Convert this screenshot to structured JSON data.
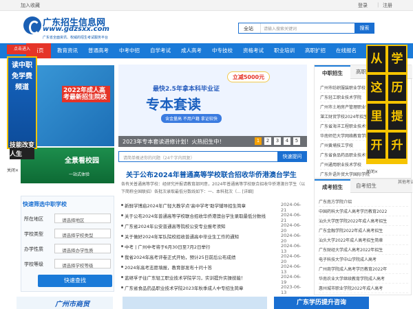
{
  "topbar": {
    "favorite": "加入收藏",
    "login": "登录",
    "sep": "|",
    "register": "注册"
  },
  "logo": {
    "title": "广东招生信息网",
    "domain": "www.gdzsxx.com",
    "slogan": "广东省全面资讯、权威的招生考试服务平台"
  },
  "search": {
    "select": "全站",
    "placeholder": "请输入搜索关键词",
    "button": "搜索"
  },
  "nav": {
    "home": "首页",
    "items": [
      "教育资讯",
      "普通高考",
      "中考中招",
      "自学考试",
      "成人高考",
      "中专技校",
      "资格考试",
      "职业培训",
      "高职扩招",
      "在线报名"
    ]
  },
  "left_float": {
    "ribbon": "点击进入",
    "v_text": "读中职免学费频道",
    "skill": "技能改变人生",
    "close": "关闭×"
  },
  "right_float": {
    "chars": [
      "学",
      "历",
      "提",
      "升"
    ],
    "chars2": [
      "从",
      "这",
      "里",
      "开",
      "始"
    ],
    "close": "关闭×"
  },
  "left_promo": {
    "tag": "2022年成人高考最新招生院校",
    "panorama": "全景看校园",
    "panorama_sub": "一站式体验"
  },
  "quick": {
    "title": "快速筛选中职学校",
    "rows": [
      {
        "label": "所在地区",
        "value": "请选择地区"
      },
      {
        "label": "学校类型",
        "value": "请选择学校类型"
      },
      {
        "label": "办学性质",
        "value": "请选择办学性质"
      },
      {
        "label": "学校等级",
        "value": "请选择学校等级"
      }
    ],
    "button": "快速查找"
  },
  "banner": {
    "badge": "立减5000元",
    "line1": "最快2.5年拿本科毕业证",
    "line2": "专本套读",
    "line3": "含金量高 不用户籍 拿证较快",
    "caption": "2023年专本套读进修计划！火热招生中！",
    "pages": [
      "1",
      "2",
      "3",
      "4",
      "5"
    ]
  },
  "ask": {
    "placeholder": "请简单概述你的问题（24个字内回复）",
    "button": "快速提问"
  },
  "headline": "关于公布2024年普通高等学校联合招收华侨港澳台学生",
  "summary": "各有关普通高等学校：经研究并报请教育部同意，2024年普通高等学校联合招收华侨港澳台学生（以下简称全国联招）各批次录取最低分数线如下：一、本科批次（... [详细]",
  "news": [
    {
      "title": "新鲜学博启2024年广轻大教学点'高中学考'助学辅导招生简章",
      "date": "2024-06-21"
    },
    {
      "title": "关于公布2024年普通高等学校联合招收华侨港澳台学生录取最低分数线",
      "date": "2024-06-21"
    },
    {
      "title": "广东省2024年公安普通高等院校公安专业报考须知",
      "date": "2024-06-20"
    },
    {
      "title": "关于做好2024年军队院校招收普通高中毕业生工作的通知",
      "date": "2024-06-20"
    },
    {
      "title": "中考 | 广州中考将于6月30日至7月2日举行",
      "date": "2024-06-13"
    },
    {
      "title": "我省2024年高考评卷正式开始，预计25日前后公布成绩",
      "date": "2024-06-20"
    },
    {
      "title": "2024年高考志愿填报，教育部发布十问十答",
      "date": "2024-06-13"
    },
    {
      "title": "蓝继孚子往广东轻工职业技术学院学习，实训提升实操技能！",
      "date": "2024-06-19"
    },
    {
      "title": "广东省食品药品职业技术学院2023年秋季成人中专招生简章",
      "date": "2023-06-13"
    }
  ],
  "tab1": {
    "active": "中职招生",
    "inactive": "高职招生",
    "items": [
      "广州市纺织服装职业学校",
      "广东轻工职业技术学院",
      "广州市土地房产管理职业学校",
      "湛江财贸学校2024年招生",
      "广东省海洋工程职业技术学校",
      "华南师范大学网络教育学院",
      "广州黄埔技工学校",
      "广东省食品药品职业技术学校",
      "广州通用职业技术学校",
      "广东外语外贸大学国际学院"
    ]
  },
  "tab2": {
    "active": "成考招生",
    "inactive": "自考招生",
    "items": [
      "广东南方学院介绍",
      "中国药科大学成人高考学历教育2022",
      "汕头大学医学院2022年成人高考招生",
      "广东金融学院2022年成人高考招生",
      "汕头大学2022年成人高考招生简章",
      "广东财经大学成人高考2022年招生",
      "电子科技大学中山学院成人高考",
      "广州商学院成人高考学历教育2022年",
      "华南农业大学继续教育学院成人高考",
      "惠州城市职业学院2022年成人高考"
    ]
  },
  "others": "其他考试",
  "bottom": {
    "left": "广州市商贸",
    "right": "广东学历提升咨询"
  }
}
